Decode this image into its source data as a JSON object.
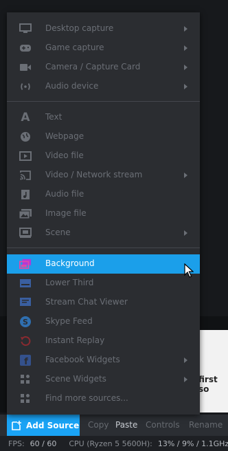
{
  "menu": {
    "groups": [
      [
        {
          "label": "Desktop capture",
          "icon": "monitor-icon",
          "submenu": true
        },
        {
          "label": "Game capture",
          "icon": "gamepad-icon",
          "submenu": true
        },
        {
          "label": "Camera / Capture Card",
          "icon": "camera-icon",
          "submenu": true
        },
        {
          "label": "Audio device",
          "icon": "audio-wave-icon",
          "submenu": true
        }
      ],
      [
        {
          "label": "Text",
          "icon": "text-icon",
          "submenu": false
        },
        {
          "label": "Webpage",
          "icon": "globe-icon",
          "submenu": false
        },
        {
          "label": "Video file",
          "icon": "video-file-icon",
          "submenu": false
        },
        {
          "label": "Video / Network stream",
          "icon": "cast-icon",
          "submenu": true
        },
        {
          "label": "Audio file",
          "icon": "music-file-icon",
          "submenu": false
        },
        {
          "label": "Image file",
          "icon": "image-icon",
          "submenu": false
        },
        {
          "label": "Scene",
          "icon": "scene-icon",
          "submenu": true
        }
      ],
      [
        {
          "label": "Background",
          "icon": "background-icon",
          "submenu": false,
          "highlighted": true
        },
        {
          "label": "Lower Third",
          "icon": "lower-third-icon",
          "submenu": false
        },
        {
          "label": "Stream Chat Viewer",
          "icon": "chat-icon",
          "submenu": false
        },
        {
          "label": "Skype Feed",
          "icon": "skype-icon",
          "submenu": false
        },
        {
          "label": "Instant Replay",
          "icon": "replay-icon",
          "submenu": false
        },
        {
          "label": "Facebook Widgets",
          "icon": "facebook-icon",
          "submenu": true
        },
        {
          "label": "Scene Widgets",
          "icon": "widgets-icon",
          "submenu": true
        },
        {
          "label": "Find more sources...",
          "icon": "widgets-icon",
          "submenu": false
        }
      ]
    ]
  },
  "toolbar": {
    "add_source_label": "Add Source",
    "copy_label": "Copy",
    "paste_label": "Paste",
    "controls_label": "Controls",
    "rename_label": "Rename"
  },
  "background": {
    "partial_text": "first so"
  },
  "status": {
    "fps_label": "FPS:",
    "fps_value": "60 / 60",
    "cpu_label": "CPU (Ryzen 5 5600H):",
    "cpu_value": "13% / 9% / 1.1GHz"
  },
  "colors": {
    "accent": "#1aa3f5",
    "highlight": "#1b9fea",
    "menu_bg": "#2b2d31",
    "disabled_text": "#6b6f76"
  }
}
